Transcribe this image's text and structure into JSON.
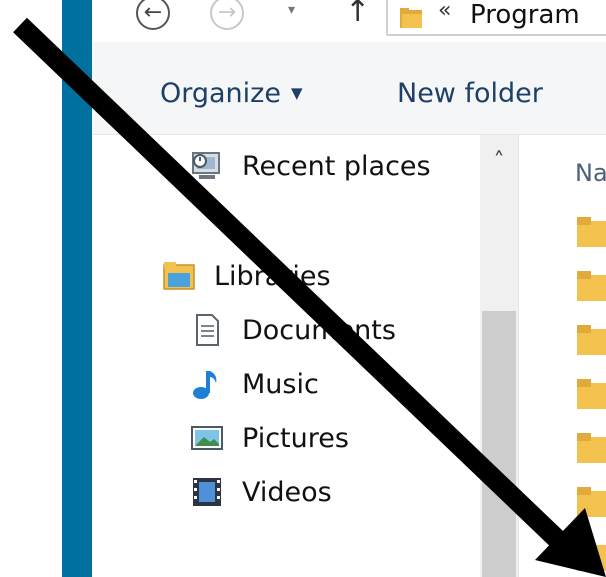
{
  "address_bar": {
    "back_glyph": "←",
    "forward_glyph": "→",
    "recent_glyph": "▾",
    "up_glyph": "↑",
    "chevron_glyph": "«",
    "path_text": "Program"
  },
  "command_bar": {
    "organize_label": "Organize",
    "organize_caret": "▼",
    "new_folder_label": "New folder"
  },
  "navigation": {
    "items": [
      {
        "label": "Recent places",
        "icon": "recent-places-icon"
      },
      {
        "label": "Libraries",
        "icon": "libraries-icon"
      },
      {
        "label": "Documents",
        "icon": "documents-icon"
      },
      {
        "label": "Music",
        "icon": "music-icon"
      },
      {
        "label": "Pictures",
        "icon": "pictures-icon"
      },
      {
        "label": "Videos",
        "icon": "videos-icon"
      }
    ],
    "scroll_up_glyph": "˄"
  },
  "content": {
    "column_name": "Na"
  },
  "colors": {
    "window_frame": "#00719e",
    "command_text": "#1e3f66",
    "folder": "#f2c14e",
    "arrow": "#000000"
  }
}
